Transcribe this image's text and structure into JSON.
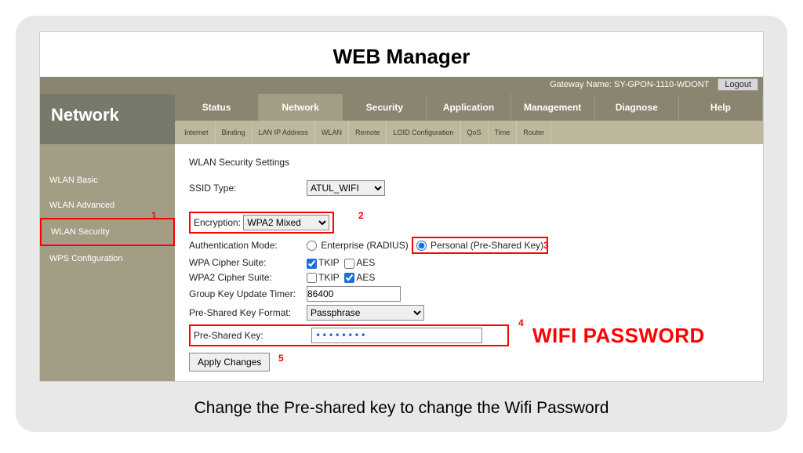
{
  "page_title": "WEB  Manager",
  "gateway_label": "Gateway Name: SY-GPON-1110-WDONT",
  "logout_label": "Logout",
  "brand": "Network",
  "main_tabs": [
    "Status",
    "Network",
    "Security",
    "Application",
    "Management",
    "Diagnose",
    "Help"
  ],
  "sub_tabs": [
    "Internet",
    "Binding",
    "LAN IP Address",
    "WLAN",
    "Remote",
    "LOID Configuration",
    "QoS",
    "Time",
    "Router"
  ],
  "sidebar": [
    "WLAN Basic",
    "WLAN Advanced",
    "WLAN Security",
    "WPS Configuration"
  ],
  "section_title": "WLAN Security Settings",
  "ssid_label": "SSID Type:",
  "ssid_value": "ATUL_WIFI",
  "encryption_label": "Encryption:",
  "encryption_value": "WPA2 Mixed",
  "auth_label": "Authentication Mode:",
  "auth_enterprise": "Enterprise (RADIUS)",
  "auth_personal": "Personal (Pre-Shared Key)",
  "wpa_cs_label": "WPA Cipher Suite:",
  "wpa2_cs_label": "WPA2 Cipher Suite:",
  "tkip": "TKIP",
  "aes": "AES",
  "gk_label": "Group Key Update Timer:",
  "gk_value": "86400",
  "fmt_label": "Pre-Shared Key Format:",
  "fmt_value": "Passphrase",
  "psk_label": "Pre-Shared Key:",
  "psk_value": "••••••••",
  "apply_label": "Apply Changes",
  "anno": {
    "n1": "1",
    "n2": "2",
    "n3": "3",
    "n4": "4",
    "n5": "5",
    "wifi": "WIFI PASSWORD"
  },
  "caption": "Change the Pre-shared key to change the Wifi Password"
}
